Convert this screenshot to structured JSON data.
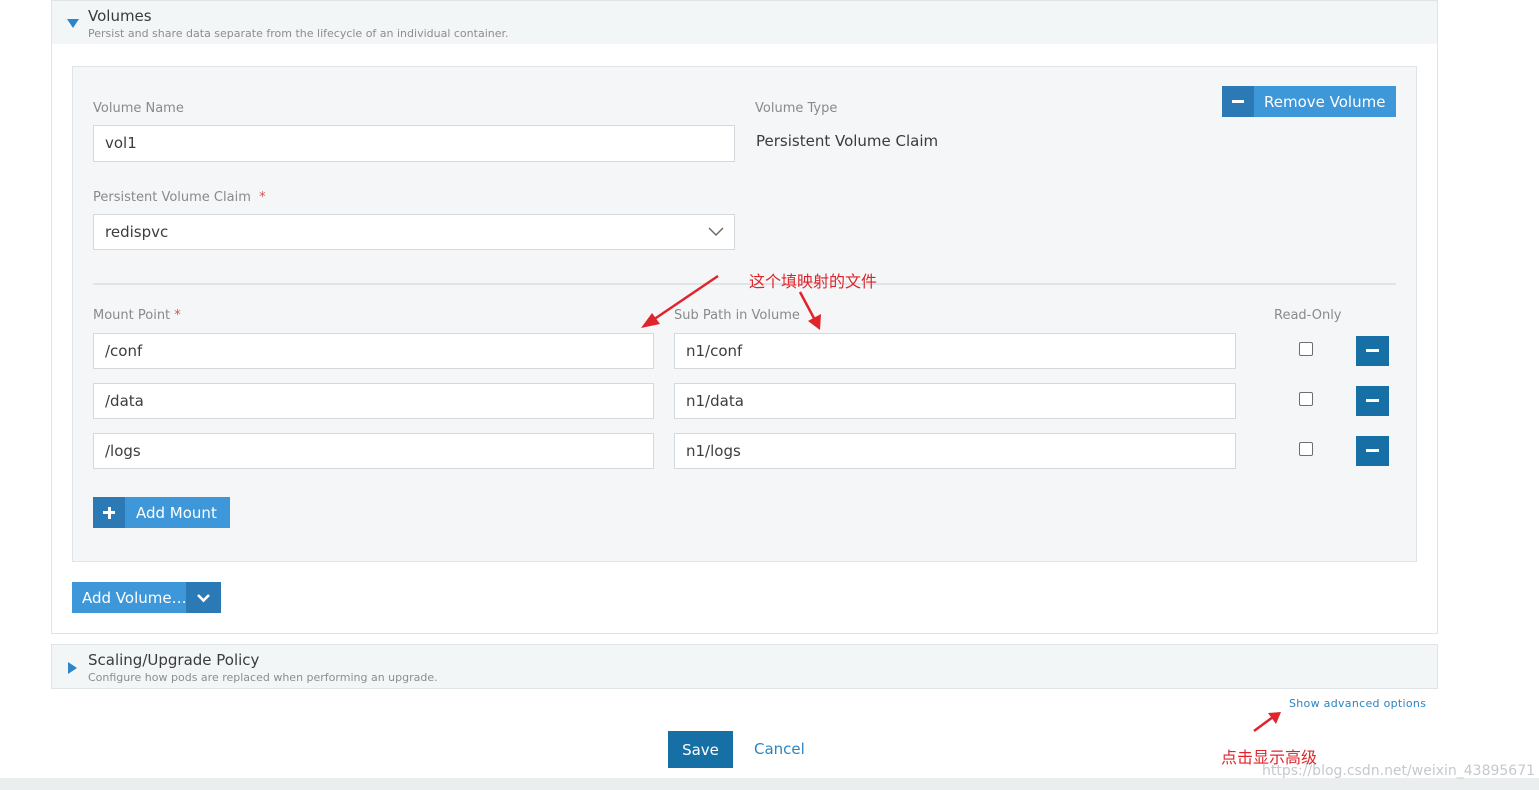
{
  "volumes_section": {
    "title": "Volumes",
    "description": "Persist and share data separate from the lifecycle of an individual container."
  },
  "volume": {
    "name_label": "Volume Name",
    "name_value": "vol1",
    "type_label": "Volume Type",
    "type_value": "Persistent Volume Claim",
    "remove_button": "Remove Volume",
    "pvc_label": "Persistent Volume Claim",
    "pvc_required": "*",
    "pvc_selected": "redispvc",
    "mount_point_label": "Mount Point",
    "mount_required": "*",
    "sub_path_label": "Sub Path in Volume",
    "read_only_label": "Read-Only",
    "mounts": [
      {
        "mount_point": "/conf",
        "sub_path": "n1/conf",
        "read_only": false
      },
      {
        "mount_point": "/data",
        "sub_path": "n1/data",
        "read_only": false
      },
      {
        "mount_point": "/logs",
        "sub_path": "n1/logs",
        "read_only": false
      }
    ],
    "add_mount_button": "Add Mount"
  },
  "add_volume_button": "Add Volume…",
  "scaling_section": {
    "title": "Scaling/Upgrade Policy",
    "description": "Configure how pods are replaced when performing an upgrade."
  },
  "advanced_link": "Show advanced options",
  "footer": {
    "save_button": "Save",
    "cancel_link": "Cancel"
  },
  "annotations": {
    "mapping_note": "这个填映射的文件",
    "advanced_note": "点击显示高级"
  },
  "watermark": "https://blog.csdn.net/weixin_43895671",
  "colors": {
    "accent": "#3d97d9",
    "accent_dark": "#1670a6",
    "annotation_red": "#e0242b"
  }
}
